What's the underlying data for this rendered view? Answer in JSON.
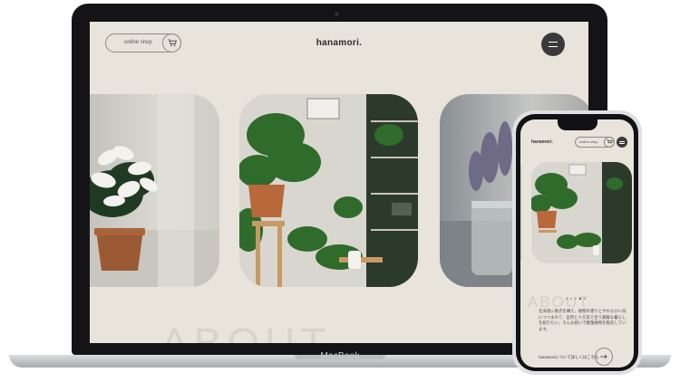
{
  "laptop": {
    "brand_label": "MacBook",
    "site": {
      "logo": "hanamori.",
      "shop_label": "online shop",
      "about_ghost": "ABOUT"
    },
    "icons": [
      "cart-icon",
      "hamburger-menu-icon",
      "camera-icon"
    ]
  },
  "phone": {
    "site": {
      "logo": "hanamori.",
      "shop_label": "online shop",
      "about_ghost": "ABOUT",
      "about_text": "北海道に拠点を構え、植物の香りとやわらかい光につつまれて、自然と人が支え合う素敵な暮らしを創りたい。そんな想いで観葉植物を販売しています。",
      "link_label": "hanamoriについて詳しくはこちら",
      "carousel_dots": 5,
      "active_dot": 3
    },
    "icons": [
      "cart-icon",
      "hamburger-menu-icon",
      "arrow-right-icon"
    ]
  },
  "colors": {
    "screen_bg": "#e8e4db",
    "menu_button": "#3a3a3c",
    "bezel": "#141416",
    "ghost_text": "#d8d3c9"
  }
}
